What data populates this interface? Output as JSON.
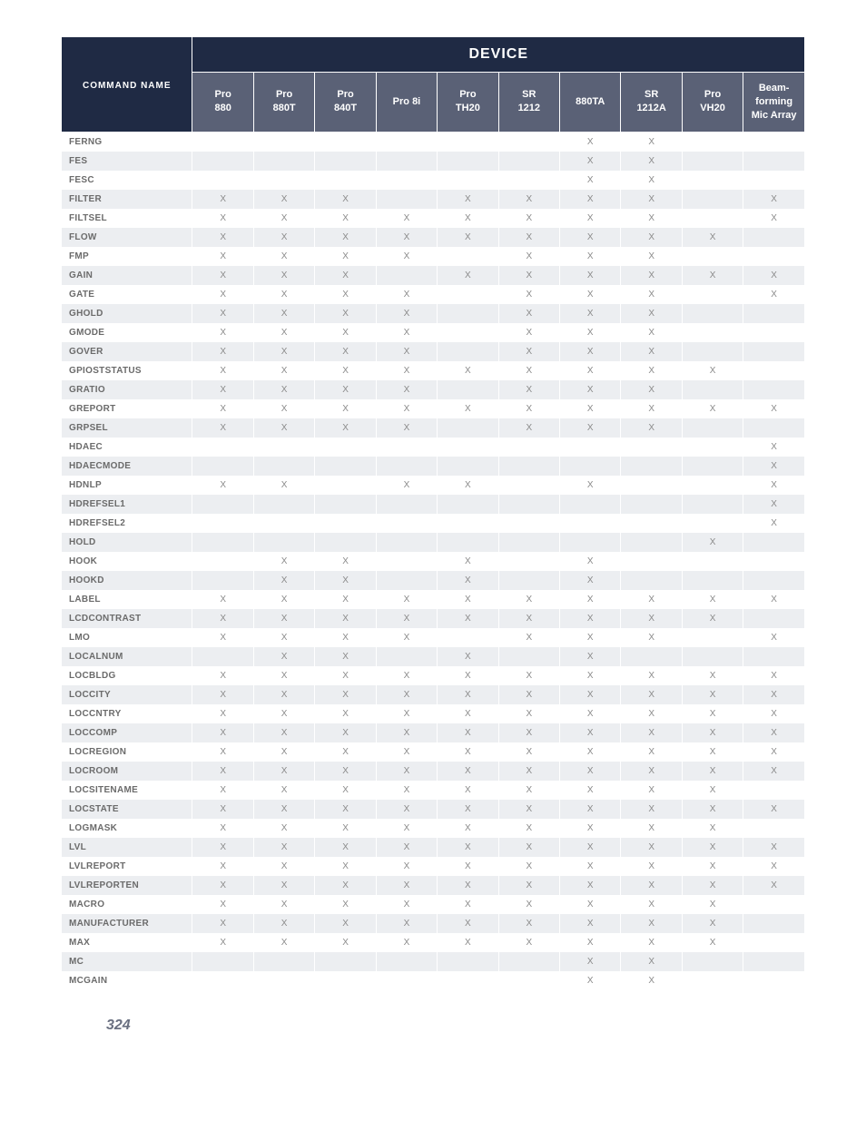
{
  "header": {
    "device_title": "DEVICE",
    "command_name_title": "COMMAND NAME",
    "columns": [
      "Pro\n880",
      "Pro\n880T",
      "Pro\n840T",
      "Pro 8i",
      "Pro\nTH20",
      "SR\n1212",
      "880TA",
      "SR\n1212A",
      "Pro\nVH20",
      "Beam-\nforming\nMic Array"
    ]
  },
  "mark": "X",
  "rows": [
    {
      "name": "FERNG",
      "marks": [
        0,
        0,
        0,
        0,
        0,
        0,
        1,
        1,
        0,
        0
      ]
    },
    {
      "name": "FES",
      "marks": [
        0,
        0,
        0,
        0,
        0,
        0,
        1,
        1,
        0,
        0
      ]
    },
    {
      "name": "FESC",
      "marks": [
        0,
        0,
        0,
        0,
        0,
        0,
        1,
        1,
        0,
        0
      ]
    },
    {
      "name": "FILTER",
      "marks": [
        1,
        1,
        1,
        0,
        1,
        1,
        1,
        1,
        0,
        1
      ]
    },
    {
      "name": "FILTSEL",
      "marks": [
        1,
        1,
        1,
        1,
        1,
        1,
        1,
        1,
        0,
        1
      ]
    },
    {
      "name": "FLOW",
      "marks": [
        1,
        1,
        1,
        1,
        1,
        1,
        1,
        1,
        1,
        0
      ]
    },
    {
      "name": "FMP",
      "marks": [
        1,
        1,
        1,
        1,
        0,
        1,
        1,
        1,
        0,
        0
      ]
    },
    {
      "name": "GAIN",
      "marks": [
        1,
        1,
        1,
        0,
        1,
        1,
        1,
        1,
        1,
        1
      ]
    },
    {
      "name": "GATE",
      "marks": [
        1,
        1,
        1,
        1,
        0,
        1,
        1,
        1,
        0,
        1
      ]
    },
    {
      "name": "GHOLD",
      "marks": [
        1,
        1,
        1,
        1,
        0,
        1,
        1,
        1,
        0,
        0
      ]
    },
    {
      "name": "GMODE",
      "marks": [
        1,
        1,
        1,
        1,
        0,
        1,
        1,
        1,
        0,
        0
      ]
    },
    {
      "name": "GOVER",
      "marks": [
        1,
        1,
        1,
        1,
        0,
        1,
        1,
        1,
        0,
        0
      ]
    },
    {
      "name": "GPIOSTSTATUS",
      "marks": [
        1,
        1,
        1,
        1,
        1,
        1,
        1,
        1,
        1,
        0
      ]
    },
    {
      "name": "GRATIO",
      "marks": [
        1,
        1,
        1,
        1,
        0,
        1,
        1,
        1,
        0,
        0
      ]
    },
    {
      "name": "GREPORT",
      "marks": [
        1,
        1,
        1,
        1,
        1,
        1,
        1,
        1,
        1,
        1
      ]
    },
    {
      "name": "GRPSEL",
      "marks": [
        1,
        1,
        1,
        1,
        0,
        1,
        1,
        1,
        0,
        0
      ]
    },
    {
      "name": "HDAEC",
      "marks": [
        0,
        0,
        0,
        0,
        0,
        0,
        0,
        0,
        0,
        1
      ]
    },
    {
      "name": "HDAECMODE",
      "marks": [
        0,
        0,
        0,
        0,
        0,
        0,
        0,
        0,
        0,
        1
      ]
    },
    {
      "name": "HDNLP",
      "marks": [
        1,
        1,
        0,
        1,
        1,
        0,
        1,
        0,
        0,
        1
      ]
    },
    {
      "name": "HDREFSEL1",
      "marks": [
        0,
        0,
        0,
        0,
        0,
        0,
        0,
        0,
        0,
        1
      ]
    },
    {
      "name": "HDREFSEL2",
      "marks": [
        0,
        0,
        0,
        0,
        0,
        0,
        0,
        0,
        0,
        1
      ]
    },
    {
      "name": "HOLD",
      "marks": [
        0,
        0,
        0,
        0,
        0,
        0,
        0,
        0,
        1,
        0
      ]
    },
    {
      "name": "HOOK",
      "marks": [
        0,
        1,
        1,
        0,
        1,
        0,
        1,
        0,
        0,
        0
      ]
    },
    {
      "name": "HOOKD",
      "marks": [
        0,
        1,
        1,
        0,
        1,
        0,
        1,
        0,
        0,
        0
      ]
    },
    {
      "name": "LABEL",
      "marks": [
        1,
        1,
        1,
        1,
        1,
        1,
        1,
        1,
        1,
        1
      ]
    },
    {
      "name": "LCDCONTRAST",
      "marks": [
        1,
        1,
        1,
        1,
        1,
        1,
        1,
        1,
        1,
        0
      ]
    },
    {
      "name": "LMO",
      "marks": [
        1,
        1,
        1,
        1,
        0,
        1,
        1,
        1,
        0,
        1
      ]
    },
    {
      "name": "LOCALNUM",
      "marks": [
        0,
        1,
        1,
        0,
        1,
        0,
        1,
        0,
        0,
        0
      ]
    },
    {
      "name": "LOCBLDG",
      "marks": [
        1,
        1,
        1,
        1,
        1,
        1,
        1,
        1,
        1,
        1
      ]
    },
    {
      "name": "LOCCITY",
      "marks": [
        1,
        1,
        1,
        1,
        1,
        1,
        1,
        1,
        1,
        1
      ]
    },
    {
      "name": "LOCCNTRY",
      "marks": [
        1,
        1,
        1,
        1,
        1,
        1,
        1,
        1,
        1,
        1
      ]
    },
    {
      "name": "LOCCOMP",
      "marks": [
        1,
        1,
        1,
        1,
        1,
        1,
        1,
        1,
        1,
        1
      ]
    },
    {
      "name": "LOCREGION",
      "marks": [
        1,
        1,
        1,
        1,
        1,
        1,
        1,
        1,
        1,
        1
      ]
    },
    {
      "name": "LOCROOM",
      "marks": [
        1,
        1,
        1,
        1,
        1,
        1,
        1,
        1,
        1,
        1
      ]
    },
    {
      "name": "LOCSITENAME",
      "marks": [
        1,
        1,
        1,
        1,
        1,
        1,
        1,
        1,
        1,
        0
      ]
    },
    {
      "name": "LOCSTATE",
      "marks": [
        1,
        1,
        1,
        1,
        1,
        1,
        1,
        1,
        1,
        1
      ]
    },
    {
      "name": "LOGMASK",
      "marks": [
        1,
        1,
        1,
        1,
        1,
        1,
        1,
        1,
        1,
        0
      ]
    },
    {
      "name": "LVL",
      "marks": [
        1,
        1,
        1,
        1,
        1,
        1,
        1,
        1,
        1,
        1
      ]
    },
    {
      "name": "LVLREPORT",
      "marks": [
        1,
        1,
        1,
        1,
        1,
        1,
        1,
        1,
        1,
        1
      ]
    },
    {
      "name": "LVLREPORTEN",
      "marks": [
        1,
        1,
        1,
        1,
        1,
        1,
        1,
        1,
        1,
        1
      ]
    },
    {
      "name": "MACRO",
      "marks": [
        1,
        1,
        1,
        1,
        1,
        1,
        1,
        1,
        1,
        0
      ]
    },
    {
      "name": "MANUFACTURER",
      "marks": [
        1,
        1,
        1,
        1,
        1,
        1,
        1,
        1,
        1,
        0
      ]
    },
    {
      "name": "MAX",
      "marks": [
        1,
        1,
        1,
        1,
        1,
        1,
        1,
        1,
        1,
        0
      ]
    },
    {
      "name": "MC",
      "marks": [
        0,
        0,
        0,
        0,
        0,
        0,
        1,
        1,
        0,
        0
      ]
    },
    {
      "name": "MCGAIN",
      "marks": [
        0,
        0,
        0,
        0,
        0,
        0,
        1,
        1,
        0,
        0
      ]
    }
  ],
  "page_number": "324"
}
